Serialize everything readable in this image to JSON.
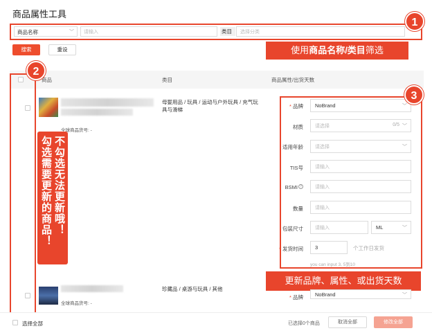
{
  "page_title": "商品属性工具",
  "search": {
    "field_select": "商品名称",
    "keyword_placeholder": "请输入",
    "category_label": "类目",
    "category_placeholder": "选择分类",
    "search_button": "搜索",
    "reset_button": "重设"
  },
  "callouts": {
    "c1_prefix": "使用",
    "c1_bold": "商品名称/类目",
    "c1_suffix": "筛选",
    "c2_col1": "不勾选无法更新哦！",
    "c2_col2": "勾选需要更新的商品！",
    "c3": "更新品牌、属性、或出货天数",
    "badge1": "1",
    "badge2": "2",
    "badge3": "3"
  },
  "table": {
    "headers": [
      "商品",
      "类目",
      "商品属性/出货天数"
    ]
  },
  "products": [
    {
      "global_sku_label": "全球商品货号: -",
      "category": "母婴用品 / 玩具 / 运动与户外玩具 / 充气玩具与滑梯"
    },
    {
      "global_sku_label": "全球商品货号: -",
      "category": "珍藏品 / 桌游与玩具 / 其他"
    }
  ],
  "attrs": {
    "brand_label": "品牌",
    "brand_value": "NoBrand",
    "material_label": "材质",
    "material_placeholder": "请选择",
    "material_count": "0/5",
    "age_label": "适用年龄",
    "age_placeholder": "请选择",
    "tis_label": "TIS号",
    "tis_placeholder": "请输入",
    "bsmi_label": "BSMI",
    "bsmi_placeholder": "请输入",
    "qty_label": "数量",
    "qty_placeholder": "请输入",
    "pack_label": "包装尺寸",
    "pack_placeholder": "请输入",
    "pack_unit": "ML",
    "ship_label": "发货时间",
    "ship_value": "3",
    "ship_unit": "个工作日发货",
    "ship_hint": "you can input 3, 5到10",
    "brand2_label": "品牌",
    "brand2_value": "NoBrand"
  },
  "footer": {
    "select_all": "选择全部",
    "selected_text": "已选择0个商品",
    "cancel_all": "取消全部",
    "update_all": "修改全部"
  },
  "colors": {
    "accent": "#e8452c",
    "primary_button": "#ee4d2d"
  }
}
